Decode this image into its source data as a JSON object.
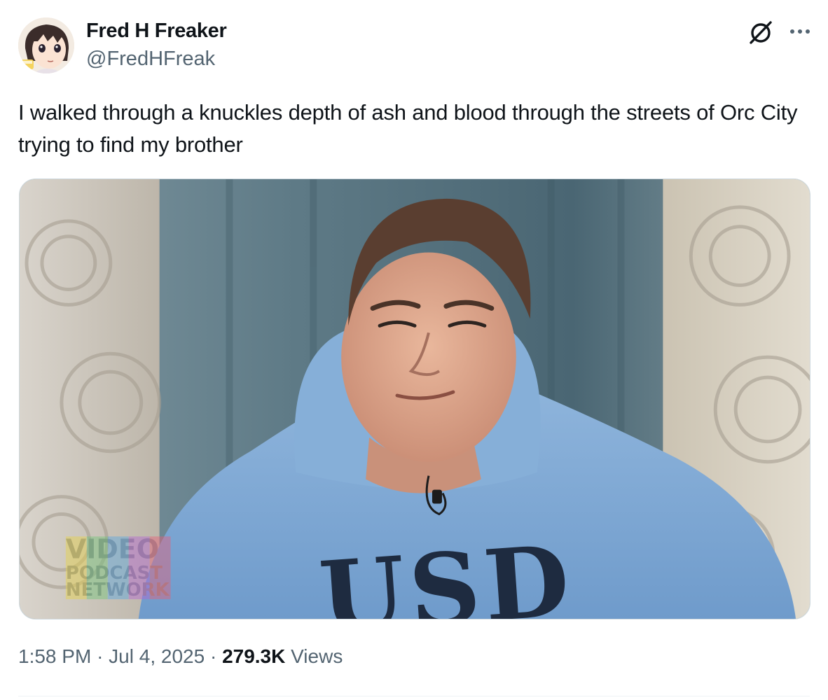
{
  "author": {
    "display_name": "Fred H Freaker",
    "handle": "@FredHFreak",
    "avatar_icon": "anime-girl-avatar"
  },
  "actions": {
    "grok_icon": "grok-icon",
    "more_icon": "more-dots-icon"
  },
  "tweet": {
    "text": "I walked through a knuckles depth of ash and blood through the streets of Orc City trying to find my brother"
  },
  "media": {
    "type": "image",
    "watermark": [
      "VIDEO",
      "PODCAST",
      "NETWORK"
    ],
    "shirt_text": "USD"
  },
  "meta": {
    "time": "1:58 PM",
    "separator": "·",
    "date": "Jul 4, 2025",
    "views_count": "279.3K",
    "views_label": "Views"
  },
  "colors": {
    "text_primary": "#0f1419",
    "text_secondary": "#536471",
    "border": "#cfd9de"
  }
}
